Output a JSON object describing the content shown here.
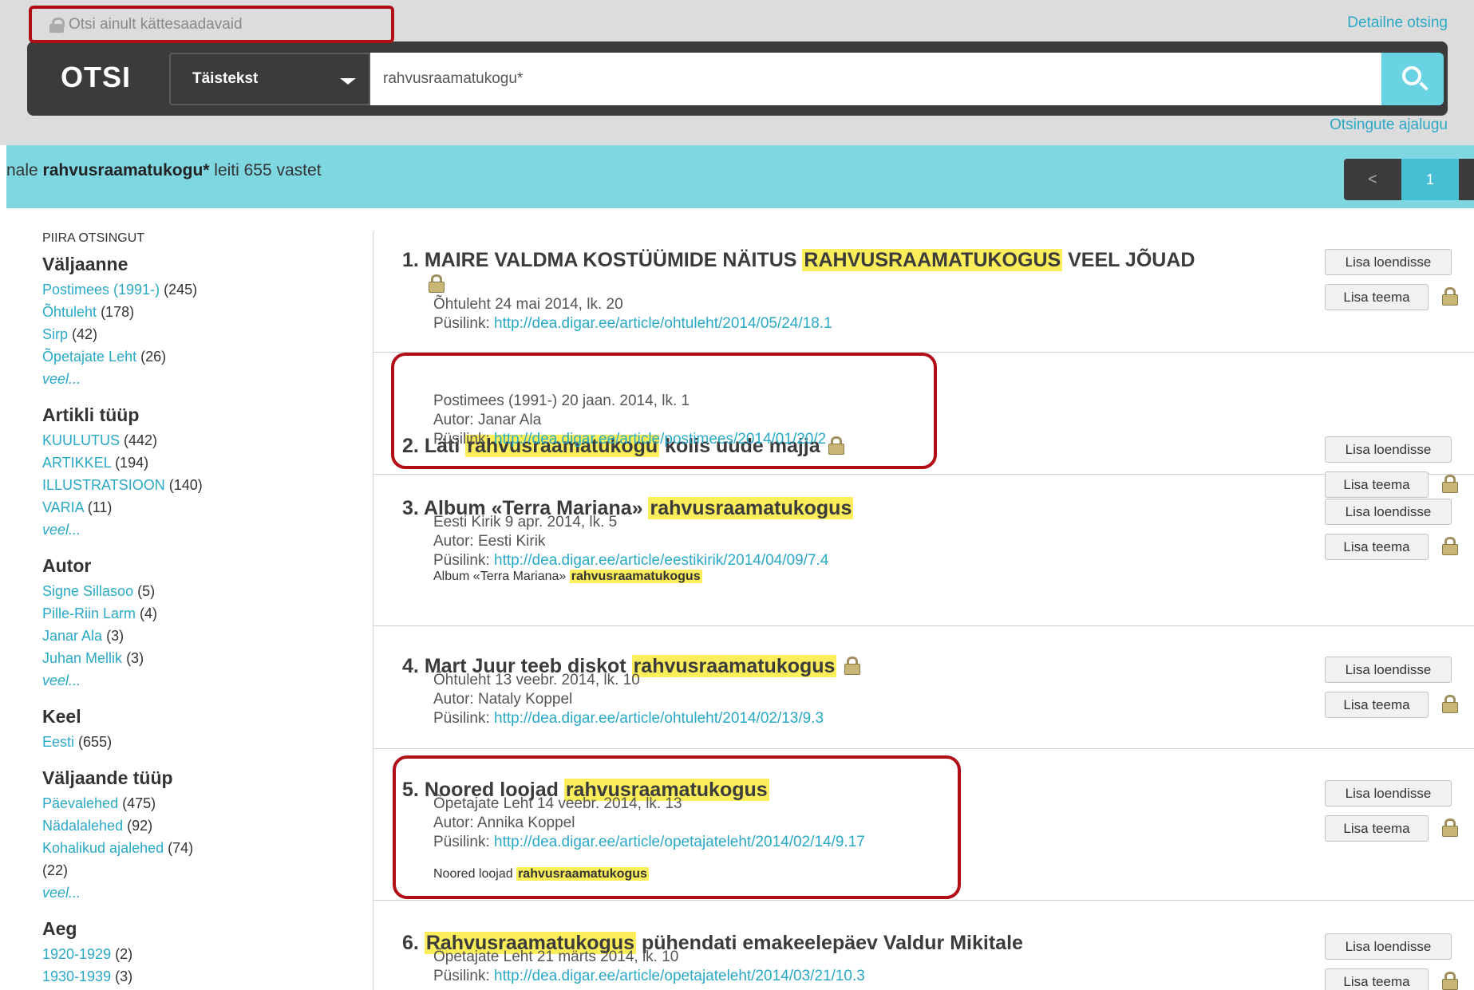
{
  "header": {
    "only_available": "Otsi ainult kättesaadavaid",
    "detailed_search": "Detailne otsing",
    "search_history": "Otsingute ajalugu"
  },
  "search": {
    "label": "OTSI",
    "type": "Täistekst",
    "query": "rahvusraamatukogu*"
  },
  "results_bar": {
    "prefix": "nale ",
    "term": "rahvusraamatukogu*",
    "suffix": " leiti 655 vastet",
    "pager_prev": "<",
    "pager_current": "1"
  },
  "sidebar": {
    "title": "PIIRA OTSINGUT",
    "facets": [
      {
        "heading": "Väljaanne",
        "items": [
          {
            "label": "Postimees (1991-)",
            "count": "(245)"
          },
          {
            "label": "Õhtuleht",
            "count": "(178)"
          },
          {
            "label": "Sirp",
            "count": "(42)"
          },
          {
            "label": "Õpetajate Leht",
            "count": "(26)"
          }
        ],
        "more": "veel..."
      },
      {
        "heading": "Artikli tüüp",
        "items": [
          {
            "label": "KUULUTUS",
            "count": "(442)"
          },
          {
            "label": "ARTIKKEL",
            "count": "(194)"
          },
          {
            "label": "ILLUSTRATSIOON",
            "count": "(140)"
          },
          {
            "label": "VARIA",
            "count": "(11)"
          }
        ],
        "more": "veel..."
      },
      {
        "heading": "Autor",
        "items": [
          {
            "label": "Signe Sillasoo",
            "count": "(5)"
          },
          {
            "label": "Pille-Riin Larm",
            "count": "(4)"
          },
          {
            "label": "Janar Ala",
            "count": "(3)"
          },
          {
            "label": "Juhan Mellik",
            "count": "(3)"
          }
        ],
        "more": "veel..."
      },
      {
        "heading": "Keel",
        "items": [
          {
            "label": "Eesti",
            "count": "(655)"
          }
        ],
        "more": ""
      },
      {
        "heading": "Väljaande tüüp",
        "items": [
          {
            "label": "Päevalehed",
            "count": "(475)"
          },
          {
            "label": "Nädalalehed",
            "count": "(92)"
          },
          {
            "label": "Kohalikud ajalehed",
            "count": "(74)"
          },
          {
            "label": "",
            "count": "(22)"
          }
        ],
        "more": "veel..."
      },
      {
        "heading": "Aeg",
        "items": [
          {
            "label": "1920-1929",
            "count": "(2)"
          },
          {
            "label": "1930-1939",
            "count": "(3)"
          }
        ],
        "more": ""
      }
    ]
  },
  "results": [
    {
      "num": "1.",
      "before": "MAIRE VALDMA KOSTÜÜMIDE NÄITUS ",
      "hl": "RAHVUSRAAMATUKOGUS",
      "after": " VEEL JÕUAD",
      "source": "Õhtuleht 24 mai 2014, lk. 20",
      "author": "",
      "permalink_label": "Püsilink:",
      "permalink": "http://dea.digar.ee/article/ohtuleht/2014/05/24/18.1",
      "snippet_before": "",
      "snippet_hl": ""
    },
    {
      "num": "2.",
      "before": "Läti ",
      "hl": "rahvusraamatukogu",
      "after": " kolis uude majja",
      "source": "Postimees (1991-) 20 jaan. 2014, lk. 1",
      "author": "Autor: Janar Ala",
      "permalink_label": "Püsilink:",
      "permalink": "http://dea.digar.ee/article/postimees/2014/01/20/2",
      "snippet_before": "",
      "snippet_hl": ""
    },
    {
      "num": "3.",
      "before": "Album «Terra Mariana» ",
      "hl": "rahvusraamatukogus",
      "after": "",
      "source": "Eesti Kirik 9 apr. 2014, lk. 5",
      "author": "Autor: Eesti Kirik",
      "permalink_label": "Püsilink:",
      "permalink": "http://dea.digar.ee/article/eestikirik/2014/04/09/7.4",
      "snippet_before": "Album «Terra Mariana» ",
      "snippet_hl": "rahvusraamatukogus"
    },
    {
      "num": "4.",
      "before": "Mart Juur teeb diskot ",
      "hl": "rahvusraamatukogus",
      "after": "",
      "source": "Õhtuleht 13 veebr. 2014, lk. 10",
      "author": "Autor: Nataly Koppel",
      "permalink_label": "Püsilink:",
      "permalink": "http://dea.digar.ee/article/ohtuleht/2014/02/13/9.3",
      "snippet_before": "",
      "snippet_hl": ""
    },
    {
      "num": "5.",
      "before": "Noored loojad ",
      "hl": "rahvusraamatukogus",
      "after": "",
      "source": "Õpetajate Leht 14 veebr. 2014, lk. 13",
      "author": "Autor: Annika Koppel",
      "permalink_label": "Püsilink:",
      "permalink": "http://dea.digar.ee/article/opetajateleht/2014/02/14/9.17",
      "snippet_before": "Noored loojad ",
      "snippet_hl": "rahvusraamatukogus"
    },
    {
      "num": "6.",
      "before": "",
      "hl": "Rahvusraamatukogus",
      "after": " pühendati emakeelepäev Valdur Mikitale",
      "source": "Õpetajate Leht 21 märts 2014, lk. 10",
      "author": "",
      "permalink_label": "Püsilink:",
      "permalink": "http://dea.digar.ee/article/opetajateleht/2014/03/21/10.3",
      "snippet_before": "",
      "snippet_hl": ""
    }
  ],
  "buttons": {
    "add_to_list": "Lisa loendisse",
    "add_topic": "Lisa teema"
  },
  "colors": {
    "accent": "#7fd7e2",
    "link": "#2aa9c6",
    "highlight": "#fbee5a",
    "annotation": "#b00d16",
    "dark": "#3b3b3b"
  }
}
